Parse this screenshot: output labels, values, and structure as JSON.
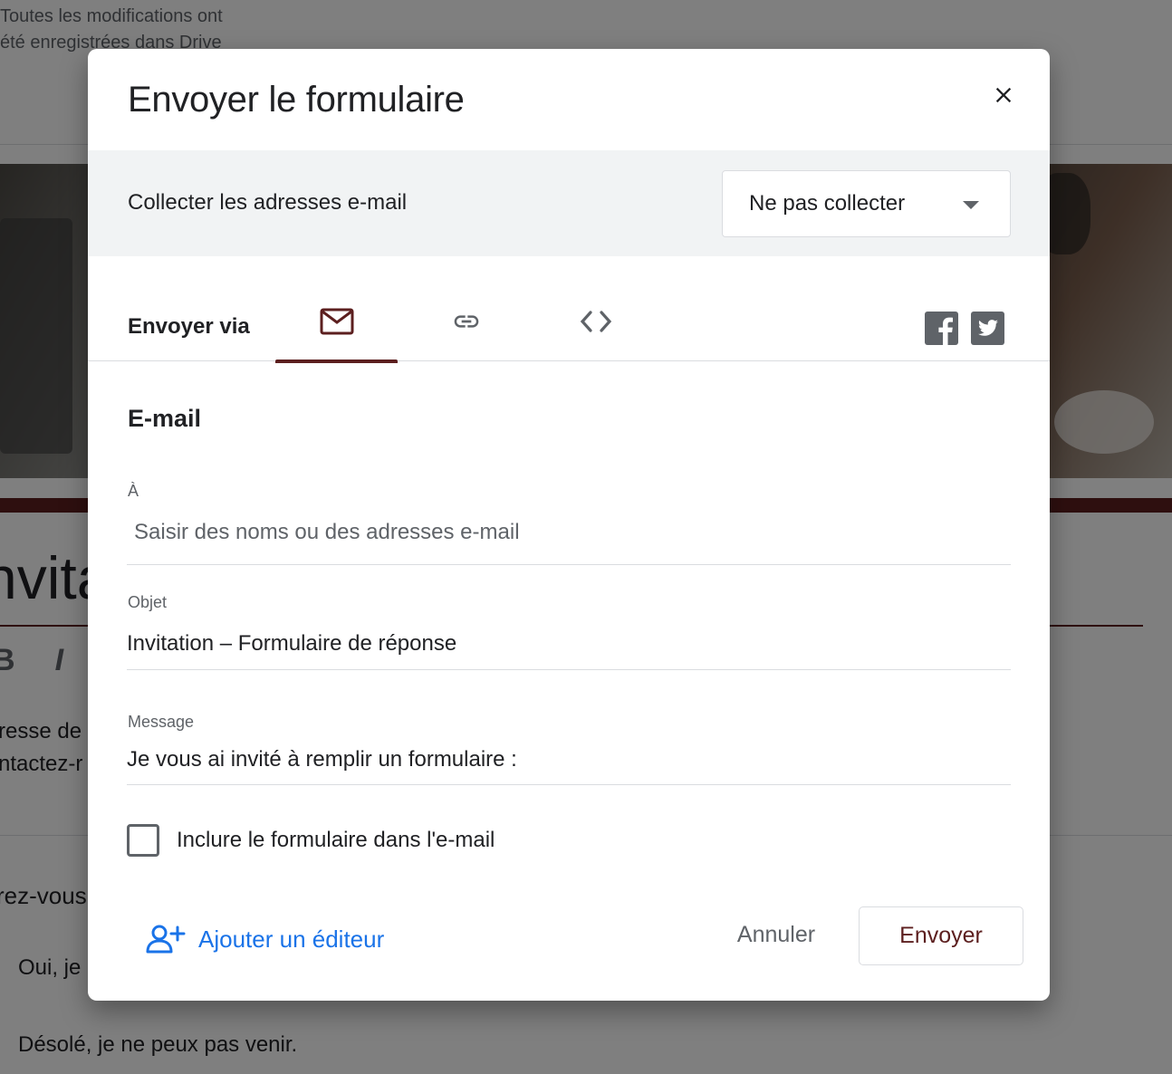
{
  "background": {
    "save_status_line1": "Toutes les modifications ont",
    "save_status_line2": "été enregistrées dans Drive",
    "form_title_fragment": "nvita",
    "toolbar_bold": "B",
    "toolbar_italic": "I",
    "description_line1": "resse de",
    "description_line2": "ntactez-r",
    "question_fragment": "rez-vous",
    "option1": "Oui, je",
    "option2": "Désolé, je ne peux pas venir."
  },
  "dialog": {
    "title": "Envoyer le formulaire",
    "close_icon": "close-icon",
    "collect": {
      "label": "Collecter les adresses e-mail",
      "selected": "Ne pas collecter"
    },
    "send_via": {
      "label": "Envoyer via",
      "tabs": [
        {
          "name": "email",
          "icon": "mail-icon",
          "active": true
        },
        {
          "name": "link",
          "icon": "link-icon",
          "active": false
        },
        {
          "name": "embed",
          "icon": "code-icon",
          "active": false
        }
      ],
      "social": [
        {
          "name": "facebook",
          "icon": "facebook-icon"
        },
        {
          "name": "twitter",
          "icon": "twitter-icon"
        }
      ]
    },
    "email": {
      "section_title": "E-mail",
      "to_label": "À",
      "to_placeholder": "Saisir des noms ou des adresses e-mail",
      "to_value": "",
      "subject_label": "Objet",
      "subject_value": "Invitation – Formulaire de réponse",
      "message_label": "Message",
      "message_value": "Je vous ai invité à remplir un formulaire :",
      "include_form_label": "Inclure le formulaire dans l'e-mail",
      "include_form_checked": false
    },
    "footer": {
      "add_editor_label": "Ajouter un éditeur",
      "cancel_label": "Annuler",
      "send_label": "Envoyer"
    }
  },
  "colors": {
    "accent": "#5c1f1f",
    "link_blue": "#1a73e8",
    "icon_gray": "#5f6368"
  }
}
